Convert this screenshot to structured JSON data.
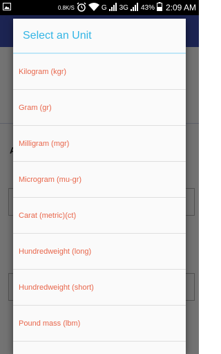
{
  "status_bar": {
    "network_speed": "0.8K/S",
    "carrier_g": "G",
    "network_3g": "3G",
    "battery": "43%",
    "time": "2:09 AM",
    "icons": [
      "gallery-icon",
      "alarm-icon",
      "wifi-icon",
      "signal-icon",
      "signal-icon",
      "battery-icon"
    ]
  },
  "dialog": {
    "title": "Select an Unit",
    "items": [
      "Kilogram (kgr)",
      "Gram (gr)",
      "Milligram (mgr)",
      "Microgram (mu-gr)",
      "Carat (metric)(ct)",
      "Hundredweight (long)",
      "Hundredweight (short)",
      "Pound mass (lbm)"
    ]
  },
  "colors": {
    "title_color": "#33b5e5",
    "item_color": "#e8664b",
    "appbar_color": "#3f51b5"
  }
}
